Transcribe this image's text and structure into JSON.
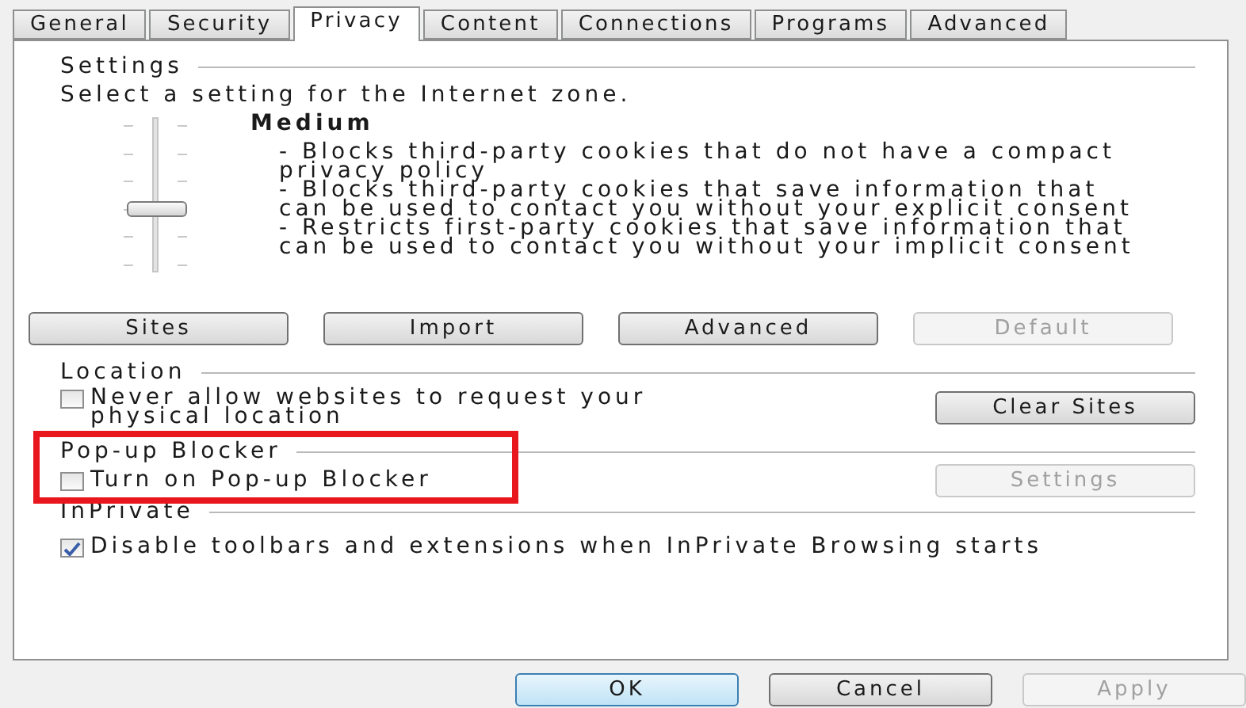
{
  "tabs": [
    {
      "label": "General",
      "selected": false
    },
    {
      "label": "Security",
      "selected": false
    },
    {
      "label": "Privacy",
      "selected": true
    },
    {
      "label": "Content",
      "selected": false
    },
    {
      "label": "Connections",
      "selected": false
    },
    {
      "label": "Programs",
      "selected": false
    },
    {
      "label": "Advanced",
      "selected": false
    }
  ],
  "settings": {
    "legend": "Settings",
    "prompt": "Select a setting for the Internet zone.",
    "slider": {
      "level": 0.4
    },
    "level_name": "Medium",
    "description": [
      "- Blocks third-party cookies that do not have a compact privacy policy",
      "- Blocks third-party cookies that save information that can be used to contact you without your explicit consent",
      "- Restricts first-party cookies that save information that can be used to contact you without your implicit consent"
    ],
    "buttons": [
      {
        "label": "Sites",
        "disabled": false
      },
      {
        "label": "Import",
        "disabled": false
      },
      {
        "label": "Advanced",
        "disabled": false
      },
      {
        "label": "Default",
        "disabled": true
      }
    ]
  },
  "location": {
    "legend": "Location",
    "checkbox": {
      "label": "Never allow websites to request your physical location",
      "checked": false
    },
    "button": {
      "label": "Clear Sites",
      "disabled": false
    }
  },
  "popup_blocker": {
    "legend": "Pop-up Blocker",
    "highlighted": true,
    "checkbox": {
      "label": "Turn on Pop-up Blocker",
      "checked": false
    },
    "button": {
      "label": "Settings",
      "disabled": true
    }
  },
  "inprivate": {
    "legend": "InPrivate",
    "checkbox": {
      "label": "Disable toolbars and extensions when InPrivate Browsing starts",
      "checked": true
    }
  },
  "footer_buttons": [
    {
      "label": "OK",
      "disabled": false,
      "default": true
    },
    {
      "label": "Cancel",
      "disabled": false,
      "default": false
    },
    {
      "label": "Apply",
      "disabled": true,
      "default": false
    }
  ]
}
